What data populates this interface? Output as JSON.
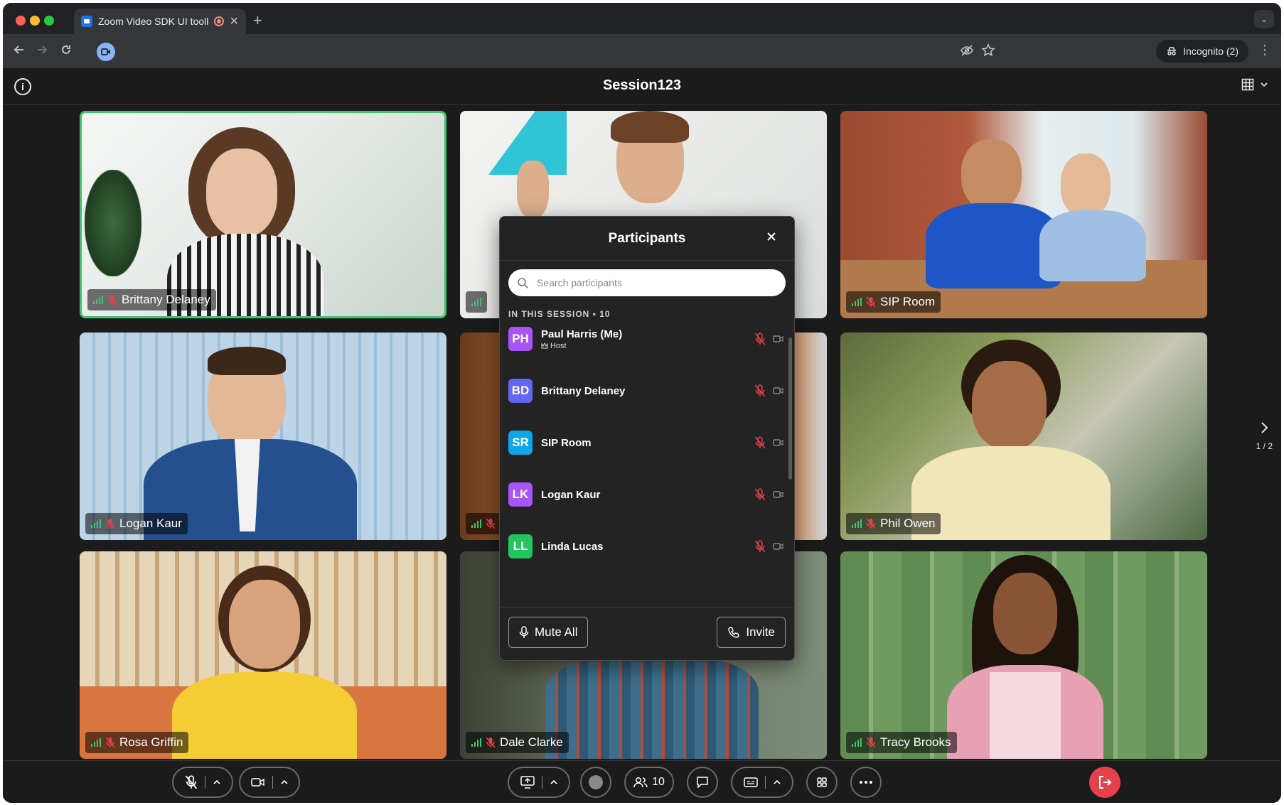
{
  "browser": {
    "tab_title": "Zoom Video SDK UI toolki",
    "incognito_label": "Incognito (2)"
  },
  "app": {
    "session_title": "Session123",
    "pager": "1 / 2"
  },
  "tiles": [
    {
      "name": "Brittany Delaney"
    },
    {
      "name": ""
    },
    {
      "name": "SIP Room"
    },
    {
      "name": "Logan Kaur"
    },
    {
      "name": ""
    },
    {
      "name": "Phil Owen"
    },
    {
      "name": "Rosa Griffin"
    },
    {
      "name": "Dale Clarke"
    },
    {
      "name": "Tracy Brooks"
    }
  ],
  "participants_panel": {
    "title": "Participants",
    "search_placeholder": "Search participants",
    "section_label": "IN THIS SESSION • 10",
    "list": [
      {
        "initials": "PH",
        "name": "Paul Harris (Me)",
        "role": "Host",
        "color": "#a855f7"
      },
      {
        "initials": "BD",
        "name": "Brittany Delaney",
        "role": "",
        "color": "#6366f1"
      },
      {
        "initials": "SR",
        "name": "SIP Room",
        "role": "",
        "color": "#0ea5e9"
      },
      {
        "initials": "LK",
        "name": "Logan Kaur",
        "role": "",
        "color": "#a855f7"
      },
      {
        "initials": "LL",
        "name": "Linda Lucas",
        "role": "",
        "color": "#22c55e"
      }
    ],
    "mute_all_label": "Mute All",
    "invite_label": "Invite"
  },
  "controls": {
    "participants_count": "10"
  },
  "colors": {
    "active_speaker": "#3ec46d",
    "leave": "#e5414b",
    "mute_red": "#e5414b"
  }
}
